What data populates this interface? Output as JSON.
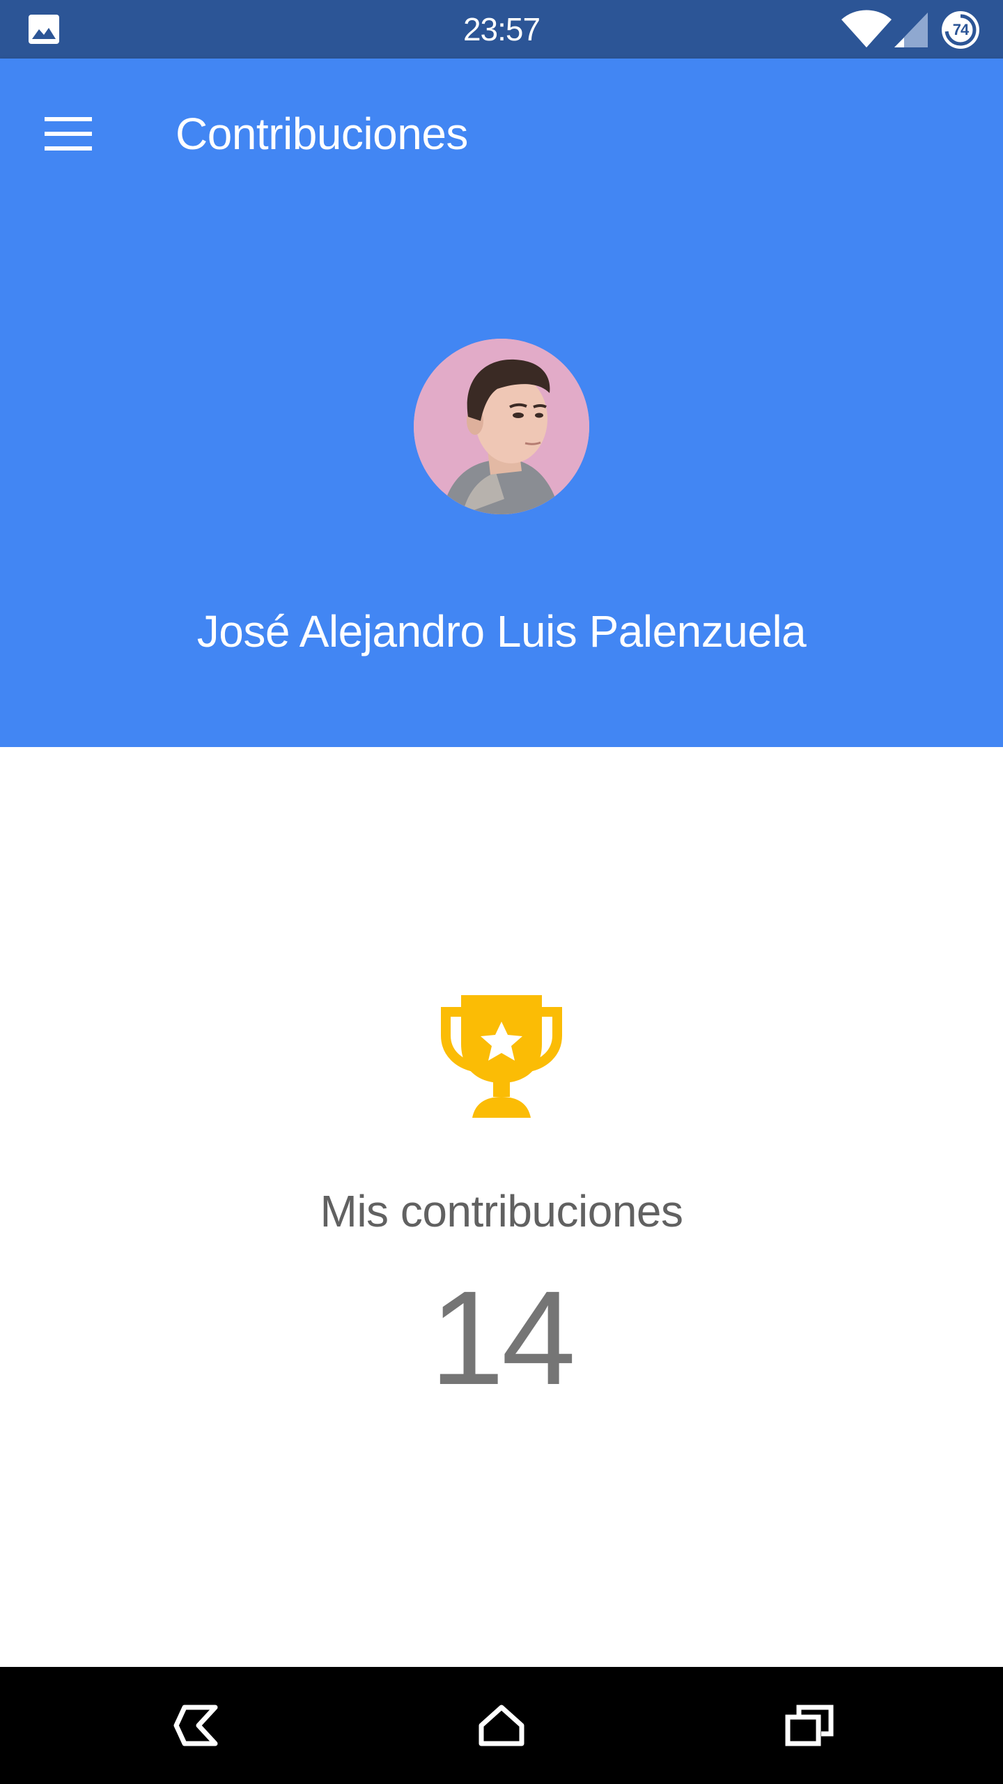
{
  "status_bar": {
    "time": "23:57",
    "battery_level": "74",
    "background_color": "#2c5596",
    "icons": [
      "gallery-icon",
      "wifi-icon",
      "cell-signal-icon",
      "battery-icon"
    ]
  },
  "app_bar": {
    "title": "Contribuciones",
    "menu_icon": "hamburger-menu-icon",
    "color": "#4286f3"
  },
  "profile": {
    "name": "José Alejandro Luis Palenzuela",
    "avatar": "profile-photo"
  },
  "contributions": {
    "icon": "trophy-icon",
    "icon_color": "#fbbc05",
    "label": "Mis contribuciones",
    "count": "14"
  },
  "nav_bar": {
    "buttons": [
      "back-icon",
      "home-icon",
      "recents-icon"
    ]
  }
}
